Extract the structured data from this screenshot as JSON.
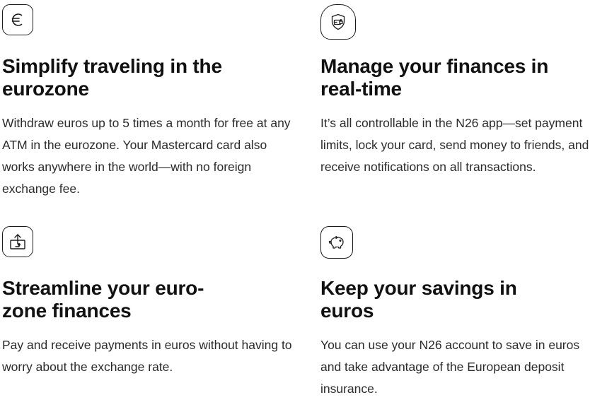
{
  "features": [
    {
      "icon": "euro-icon",
      "title_line1": "Simplify traveling in the",
      "title_line2": "eurozone",
      "description": "Withdraw euros up to 5 times a month for free at any ATM in the eurozone. Your Mastercard card also works anywhere in the world—with no foreign exchange fee."
    },
    {
      "icon": "shield-card-lock-icon",
      "title_line1": "Manage your finances in",
      "title_line2": "real-time",
      "description": "It’s all controllable in the N26 app—set payment limits, lock your card, send money to friends, and receive notifications on all transactions."
    },
    {
      "icon": "money-transfer-upload-icon",
      "title_line1": "Streamline your euro-",
      "title_line2": "zone finances",
      "description": "Pay and receive payments in euros without having to worry about the exchange rate."
    },
    {
      "icon": "piggy-bank-icon",
      "title_line1": "Keep your savings in",
      "title_line2": "euros",
      "description": "You can use your N26 account to save in euros and take advantage of the European deposit insurance."
    }
  ]
}
